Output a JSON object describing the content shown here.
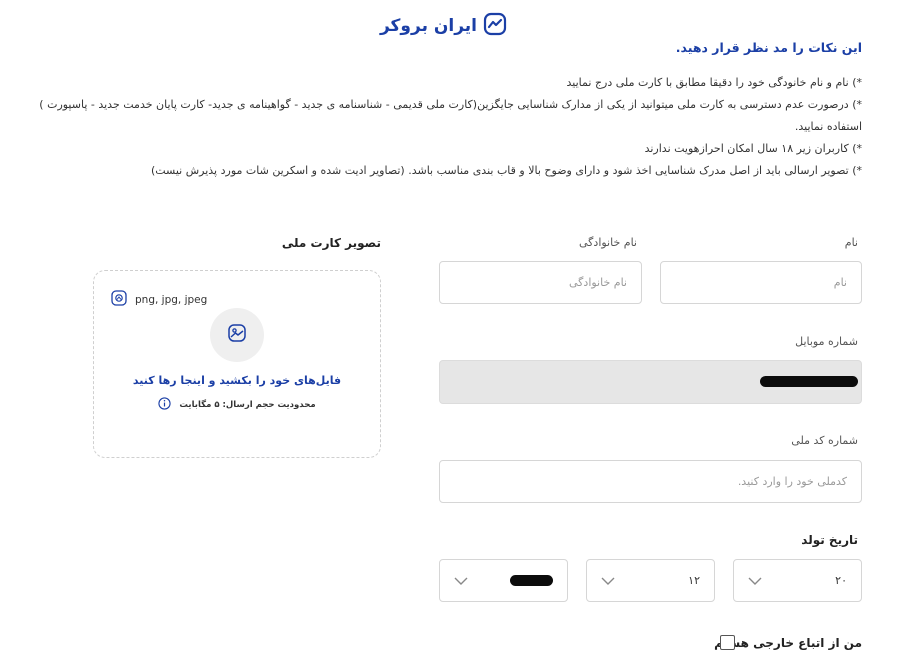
{
  "brand": {
    "name": "ایران بروکر",
    "color": "#1b3fa6"
  },
  "notes": {
    "title": "این نکات را مد نظر قرار دهید.",
    "items": [
      "*)  نام و نام خانودگی خود را دقیقا مطابق با کارت ملی درج نمایید",
      "*)  درصورت عدم دسترسی به کارت ملی میتوانید از یکی از مدارک شناسایی جایگزین(کارت ملی قدیمی - شناسنامه ی جدید - گواهینامه ی جدید- کارت پایان خدمت جدید - پاسپورت ) استفاده نمایید.",
      "*)  کاربران زیر ۱۸ سال امکان احرازهویت ندارند",
      "*)  تصویر ارسالی باید از اصل مدرک شناسایی اخذ شود و دارای وضوح بالا و قاب بندی مناسب باشد. (تصاویر ادیت شده و اسکرین شات مورد پذیرش نیست)"
    ]
  },
  "form": {
    "first_name": {
      "label": "نام",
      "placeholder": "نام"
    },
    "last_name": {
      "label": "نام خانوادگی",
      "placeholder": "نام خانوادگی"
    },
    "mobile": {
      "label": "شماره موبایل"
    },
    "national_code": {
      "label": "شماره کد ملی",
      "placeholder": "کدملی خود را وارد کنید."
    },
    "birth_date": {
      "label": "تاریخ تولد",
      "day": "۲۰",
      "month": "۱۲"
    },
    "foreign_checkbox": {
      "label": "من از اتباع خارجی هستم"
    }
  },
  "upload": {
    "title": "تصویر کارت ملی",
    "formats": "png, jpg, jpeg",
    "drop_text": "فایل‌های خود را بکشید و اینجا رها کنید",
    "limit_text": "محدودیت حجم ارسال: ۵ مگابایت"
  },
  "icons": {
    "logo": "chart-trend-icon",
    "formats": "file-image-icon",
    "upload": "image-upload-icon",
    "info": "info-circle-icon",
    "dropdown": "chevron-down-icon"
  }
}
